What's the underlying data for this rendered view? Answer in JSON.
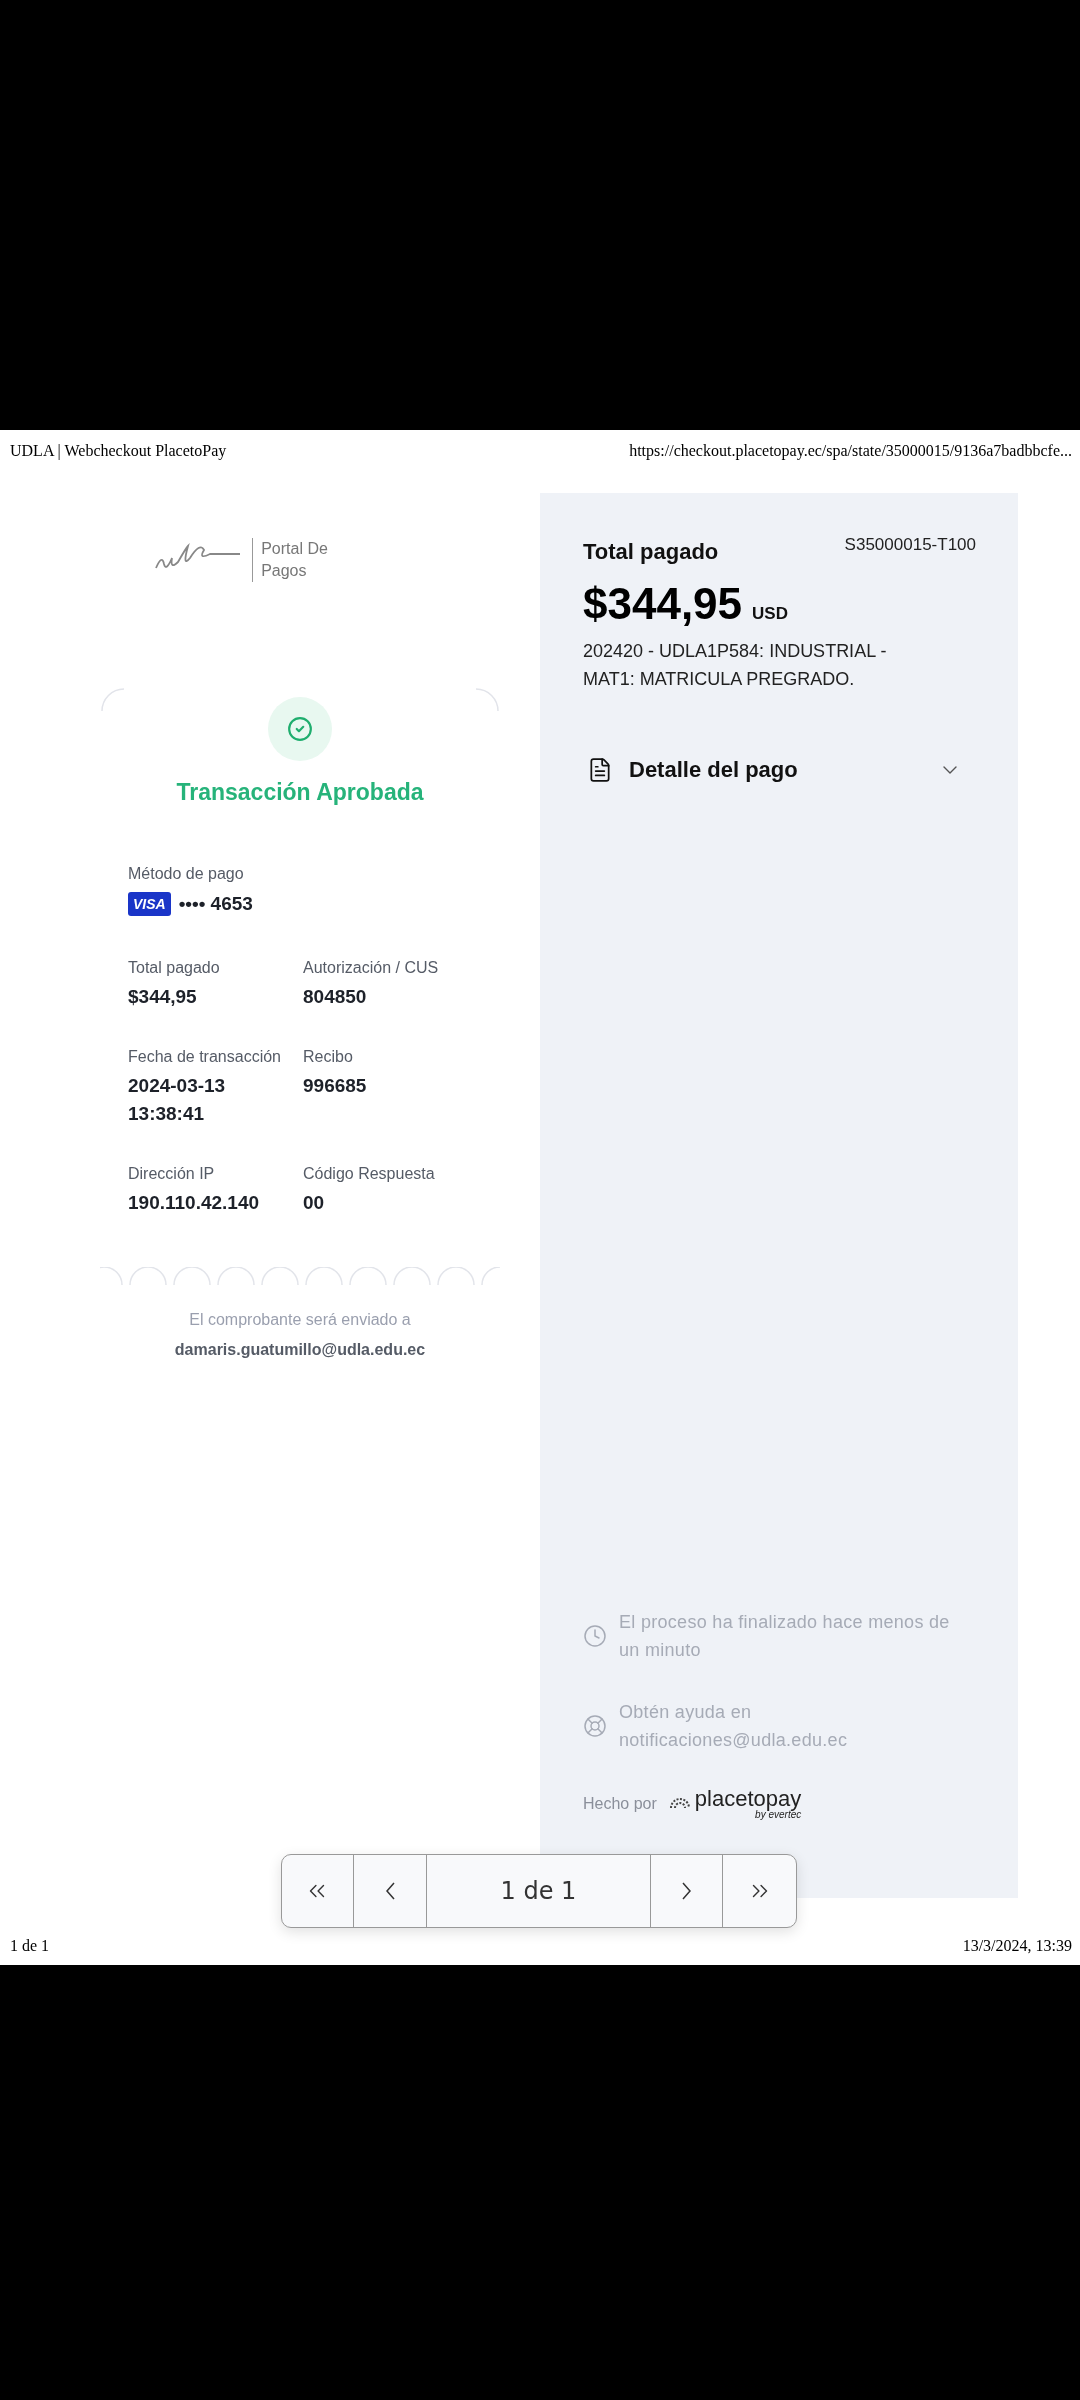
{
  "header": {
    "title": "UDLA | Webcheckout PlacetoPay",
    "url": "https://checkout.placetopay.ec/spa/state/35000015/9136a7badbbcfe..."
  },
  "logo": {
    "lines": [
      "Portal De",
      "Pagos"
    ]
  },
  "status": {
    "title": "Transacción Aprobada"
  },
  "payment_method": {
    "label": "Método de pago",
    "brand": "VISA",
    "masked": "•••• 4653"
  },
  "details": [
    {
      "label": "Total pagado",
      "value": "$344,95"
    },
    {
      "label": "Autorización / CUS",
      "value": "804850"
    },
    {
      "label": "Fecha de transacción",
      "value": "2024-03-13 13:38:41"
    },
    {
      "label": "Recibo",
      "value": "996685"
    },
    {
      "label": "Dirección IP",
      "value": "190.110.42.140"
    },
    {
      "label": "Código Respuesta",
      "value": "00"
    }
  ],
  "receipt": {
    "text": "El comprobante será enviado a",
    "email": "damaris.guatumillo@udla.edu.ec"
  },
  "summary": {
    "title": "Total pagado",
    "reference": "S35000015-T100",
    "amount": "$344,95",
    "currency": "USD",
    "description": "202420 - UDLA1P584: INDUSTRIAL - MAT1: MATRICULA PREGRADO."
  },
  "accordion": {
    "label": "Detalle del pago",
    "expanded": false
  },
  "notes": [
    {
      "kind": "clock",
      "text": "El proceso ha finalizado hace menos de un minuto"
    },
    {
      "kind": "help",
      "text": "Obtén ayuda en notificaciones@udla.edu.ec"
    }
  ],
  "made_by": {
    "label": "Hecho por",
    "brand": "placetopay",
    "by": "by evertec"
  },
  "pager": {
    "page": "1 de 1"
  },
  "footer": {
    "page": "1 de 1",
    "date": "13/3/2024, 13:39"
  }
}
